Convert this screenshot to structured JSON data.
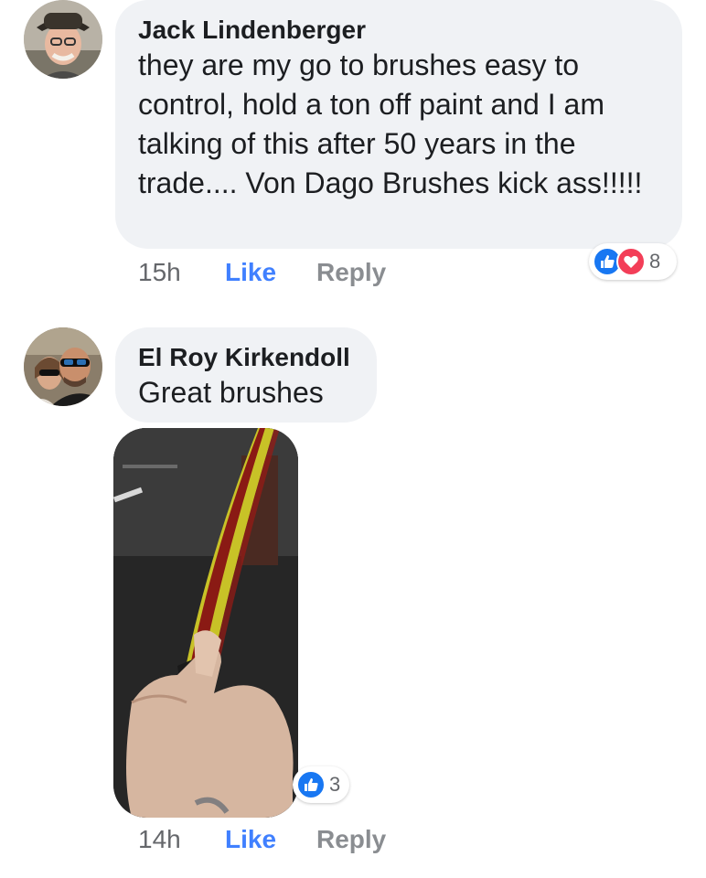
{
  "comments": [
    {
      "author": "Jack Lindenberger",
      "text": "they are my go to brushes easy to control, hold a ton off paint and I am talking of this after 50 years in the trade.... Von Dago Brushes kick ass!!!!!",
      "time": "15h",
      "like_label": "Like",
      "reply_label": "Reply",
      "reaction_count": "8",
      "reaction_icons": [
        "like-icon",
        "love-icon"
      ]
    },
    {
      "author": "El Roy Kirkendoll",
      "text": "Great brushes",
      "time": "14h",
      "like_label": "Like",
      "reply_label": "Reply",
      "reaction_count": "3",
      "reaction_icons": [
        "like-icon"
      ]
    }
  ],
  "colors": {
    "bubble": "#f0f2f5",
    "like_blue": "#4080ff",
    "love_red": "#f33e58",
    "meta_gray": "#65676b"
  }
}
